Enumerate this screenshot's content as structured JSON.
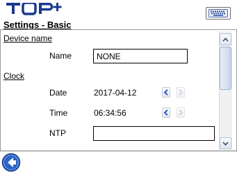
{
  "header": {
    "logo_text": "TOP+",
    "page_title": "Settings - Basic",
    "keyboard_icon": "keyboard-icon"
  },
  "sections": {
    "device_name": {
      "heading": "Device name",
      "name_label": "Name",
      "name_value": "NONE"
    },
    "clock": {
      "heading": "Clock",
      "date_label": "Date",
      "date_value": "2017-04-12",
      "time_label": "Time",
      "time_value": "06:34:56",
      "ntp_label": "NTP",
      "ntp_value": ""
    }
  },
  "footer": {
    "back_icon": "back-arrow-icon"
  },
  "colors": {
    "logo": "#1a3a8f",
    "back_button": "#2a63c8",
    "arrow_active": "#2b56c8",
    "arrow_disabled": "#a8aebb"
  }
}
